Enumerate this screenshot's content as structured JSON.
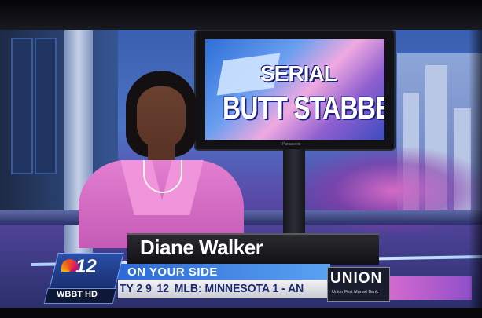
{
  "screen_graphic": {
    "line1": "SERIAL",
    "line2": "BUTT STABBER",
    "monitor_brand": "Panasonic"
  },
  "lower_third": {
    "name": "Diane Walker",
    "tagline": "ON YOUR SIDE",
    "logo_number": "12",
    "station_id": "WBBT HD",
    "ticker_before_logo": "TY 2 9",
    "ticker_logo": "12",
    "ticker_after_logo": "MLB: MINNESOTA 1 - AN"
  },
  "sponsor": {
    "name": "UNION",
    "sub": "Union First Market Bank"
  },
  "colors": {
    "jacket": "#d76bc6",
    "tagline_blue": "#3f86e6",
    "name_bar": "#1c1c20"
  }
}
